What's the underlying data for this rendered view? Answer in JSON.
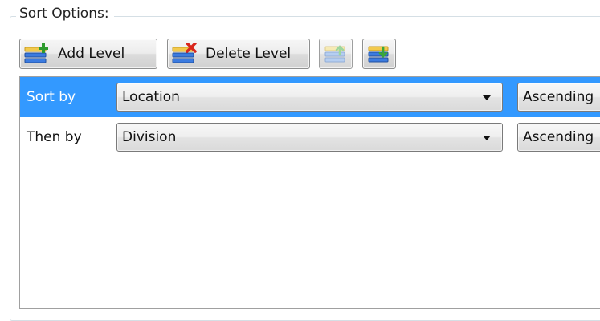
{
  "groupbox": {
    "title": "Sort Options:"
  },
  "toolbar": {
    "add_label": "Add Level",
    "delete_label": "Delete Level",
    "icons": {
      "add": "add-level-icon",
      "delete": "delete-level-icon",
      "move_up": "move-up-icon",
      "move_down": "move-down-icon"
    }
  },
  "rows": [
    {
      "caption": "Sort by",
      "field": "Location",
      "order": "Ascending",
      "selected": true
    },
    {
      "caption": "Then by",
      "field": "Division",
      "order": "Ascending",
      "selected": false
    }
  ],
  "colors": {
    "selection": "#3399ff",
    "icon_blue": "#2f6fd1",
    "add_green": "#2e9b2e",
    "delete_red": "#d9261c",
    "arrow_green": "#3aa63a"
  }
}
